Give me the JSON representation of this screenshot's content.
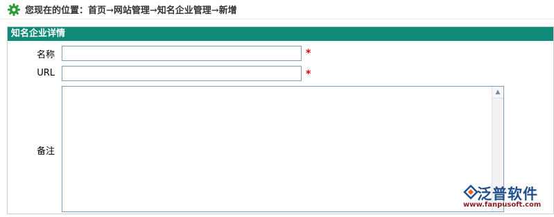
{
  "breadcrumb": {
    "text": "您现在的位置：首页→网站管理→知名企业管理→新增"
  },
  "panel": {
    "title": "知名企业详情"
  },
  "form": {
    "name_label": "名称",
    "name_value": "",
    "url_label": "URL",
    "url_value": "",
    "required_mark": "*",
    "note_label": "备注",
    "note_value": ""
  },
  "watermark": {
    "brand": "泛普软件",
    "url": "www.fanpusoft.com"
  },
  "colors": {
    "header_bg": "#0f8a78",
    "required": "#e20000",
    "gear": "#2d9a3a",
    "brand": "#1f4f8f"
  }
}
